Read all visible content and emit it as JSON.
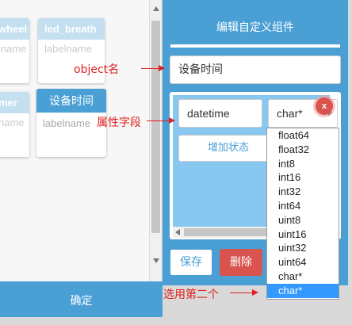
{
  "left": {
    "cards": [
      {
        "title": "wheel",
        "subtitle": "lname"
      },
      {
        "title": "led_breath",
        "subtitle": "labelname"
      },
      {
        "title": "mer",
        "subtitle": "name"
      },
      {
        "title": "设备时间",
        "subtitle": "labelname"
      }
    ],
    "confirm_label": "确定"
  },
  "dialog": {
    "title": "编辑自定义组件",
    "object_name": "设备时间",
    "property_name": "datetime",
    "property_type": "char*",
    "delete_x": "x",
    "add_state_label": "增加状态",
    "save_label": "保存",
    "delete_label": "删除"
  },
  "dropdown": {
    "options": [
      "float64",
      "float32",
      "int8",
      "int16",
      "int32",
      "int64",
      "uint8",
      "uint16",
      "uint32",
      "uint64",
      "char*",
      "char*"
    ],
    "selected_index": 11
  },
  "annotations": {
    "object_label": "object名",
    "attribute_label": "属性字段",
    "select_label": "选用第二个"
  },
  "colors": {
    "accent": "#4a9fd5",
    "danger": "#d9534f",
    "annotation": "#e02020"
  }
}
